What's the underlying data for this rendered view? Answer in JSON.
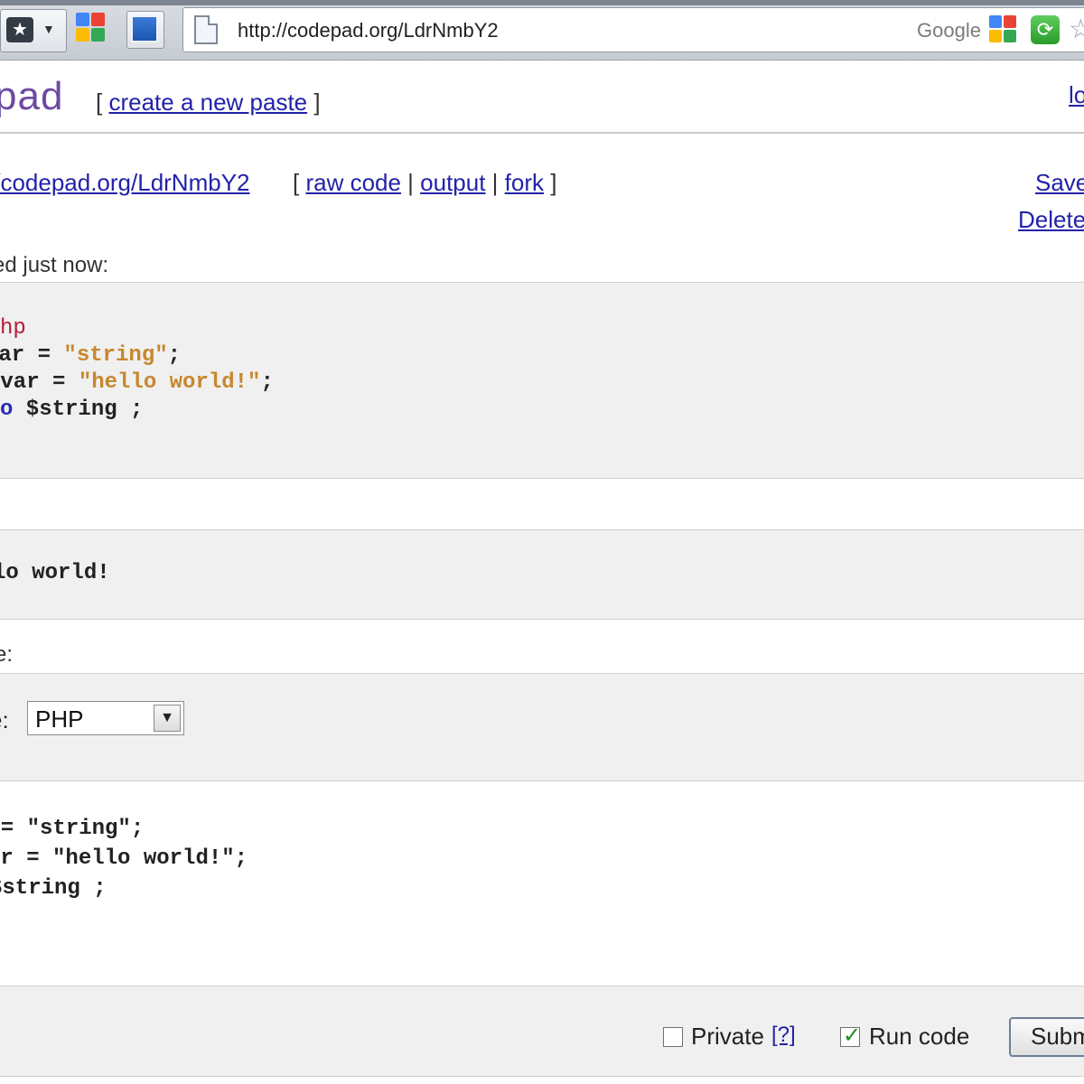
{
  "browser": {
    "url": "http://codepad.org/LdrNmbY2",
    "search_engine": "Google"
  },
  "header": {
    "site_title": "pad",
    "new_paste_open": "[ ",
    "new_paste_link": "create a new paste",
    "new_paste_close": " ]",
    "login_link": "lo"
  },
  "paste_info": {
    "url_link": "//codepad.org/LdrNmbY2",
    "open_bracket": "[ ",
    "raw_code_link": "raw code",
    "sep1": " | ",
    "output_link": "output",
    "sep2": " | ",
    "fork_link": "fork",
    "close_bracket": " ]",
    "save_link": "Save",
    "delete_link": "Delete",
    "pasted_time": "ed just now:"
  },
  "code_view": {
    "line1": "hp",
    "line2_var": "var = ",
    "line2_str": "\"string\"",
    "line2_end": ";",
    "line3_var": "yvar = ",
    "line3_str": "\"hello world!\"",
    "line3_end": ";",
    "line4_kw": "o",
    "line4_rest": " $string ;"
  },
  "output": {
    "text": "lo world!"
  },
  "create_form": {
    "label": "e:",
    "language_label": "e:",
    "language_selected": "PHP",
    "textarea_lines": [
      "r = \"string\";",
      "ar = \"hello world!\";",
      "$string ;"
    ],
    "private_label": "Private",
    "private_help": "[?]",
    "run_code_label": "Run code",
    "submit_label": "Subm"
  },
  "colors": {
    "link": "#2222aa",
    "title": "#6d4aa0",
    "keyword": "#b02038",
    "string": "#c8872e",
    "panel_bg": "#f0f0f0"
  }
}
